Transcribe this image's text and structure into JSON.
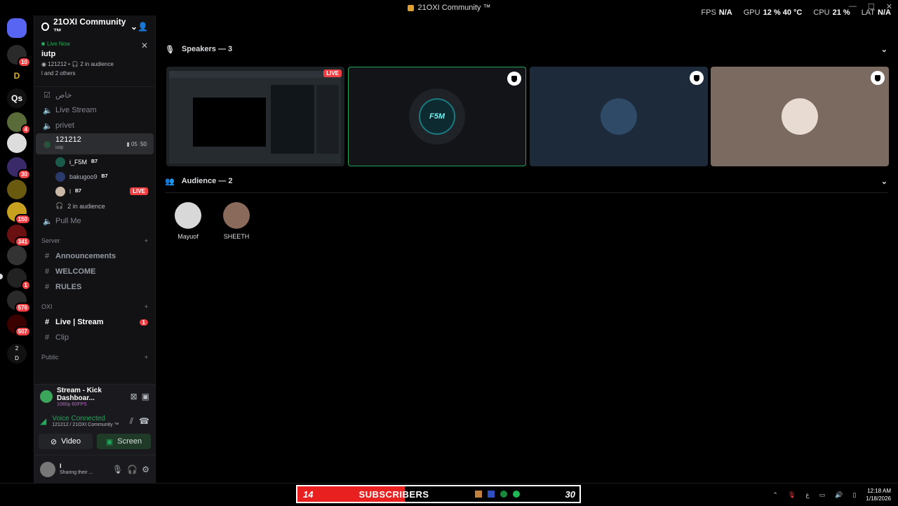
{
  "window": {
    "title": "21OXI Community ™",
    "controls": [
      "—",
      "☐",
      "✕"
    ]
  },
  "overlay": {
    "fps_label": "FPS",
    "fps_value": "N/A",
    "gpu_label": "GPU",
    "gpu_value": "12 %",
    "gpu_temp": "40 °C",
    "cpu_label": "CPU",
    "cpu_value": "21 %",
    "lat_label": "LAT",
    "lat_value": "N/A"
  },
  "rail": {
    "badges": [
      "10",
      "4",
      "30",
      "150",
      "341",
      "1",
      "576",
      "507"
    ],
    "text_icons": [
      "Qs",
      "2",
      "D"
    ]
  },
  "sidebar": {
    "server_name": "21OXI Community ™",
    "live_card": {
      "status": "Live Now",
      "title": "iutp",
      "channel": "121212",
      "audience": "2 in audience",
      "others": "l and 2 others"
    },
    "channels_top": [
      {
        "label": "خاص"
      },
      {
        "label": "Live Stream"
      },
      {
        "label": "privet"
      }
    ],
    "active_channel": {
      "label": "121212",
      "sublabel": "iutp",
      "cam_count": "05",
      "limit": "50"
    },
    "participants": [
      {
        "name": "i_F5M",
        "tag": "B7"
      },
      {
        "name": "bakugoo9",
        "tag": "B7"
      },
      {
        "name": "l",
        "tag": "B7",
        "live": "LIVE"
      }
    ],
    "audience_line": "2 in audience",
    "pull_me": "Pull Me",
    "categories": [
      {
        "label": "Server",
        "channels": [
          "Announcements",
          "WELCOME",
          "RULES"
        ]
      },
      {
        "label": "OXI",
        "channels": [
          "Live | Stream",
          "Clip"
        ],
        "unread_badge": "1"
      },
      {
        "label": "Public",
        "channels": []
      }
    ]
  },
  "panel": {
    "stream_title": "Stream - Kick Dashboar...",
    "stream_quality": "1080p 60FPS",
    "voice_status": "Voice Connected",
    "voice_channel": "121212 / 21OXI Community ™",
    "video_label": "Video",
    "screen_label": "Screen",
    "user_name": "l",
    "user_status": "Sharing their ..."
  },
  "main": {
    "speakers_heading": "Speakers — 3",
    "audience_heading": "Audience — 2",
    "stream_live": "LIVE",
    "speaker_tile_label": "F5M",
    "audience": [
      {
        "name": "Mayuof"
      },
      {
        "name": "SHEETH"
      }
    ]
  },
  "taskbar": {
    "sub_count_left": "14",
    "sub_text": "SUBSCRIBERS",
    "sub_count_right": "30",
    "lang": "ع",
    "time": "12:18 AM",
    "date": "1/18/2026"
  },
  "colors": {
    "accent_green": "#23a55a",
    "live_red": "#f23f43",
    "bg": "#000000"
  }
}
